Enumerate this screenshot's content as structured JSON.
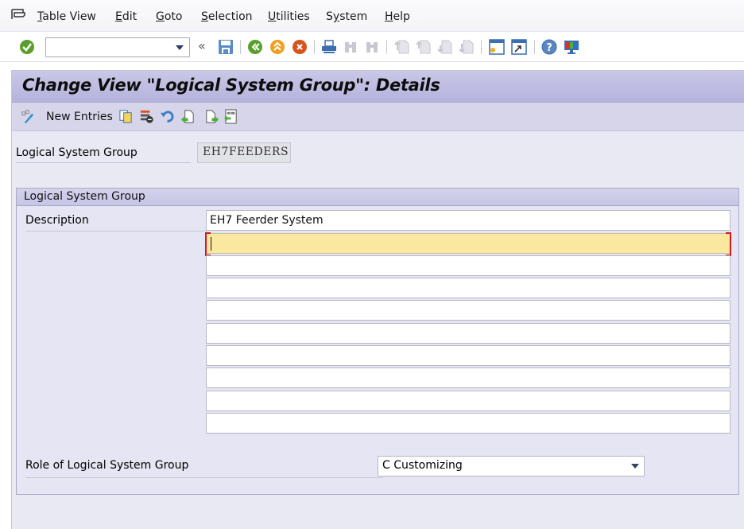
{
  "menubar": {
    "items": [
      {
        "label": "Table View",
        "mnemonic": "T"
      },
      {
        "label": "Edit",
        "mnemonic": "E"
      },
      {
        "label": "Goto",
        "mnemonic": "G"
      },
      {
        "label": "Selection",
        "mnemonic": "S"
      },
      {
        "label": "Utilities",
        "mnemonic": "U"
      },
      {
        "label": "System",
        "mnemonic": "y"
      },
      {
        "label": "Help",
        "mnemonic": "H"
      }
    ]
  },
  "toolbar": {
    "command_field_value": "",
    "icons": [
      "enter-icon",
      "save-icon",
      "back-icon",
      "exit-icon",
      "cancel-icon",
      "print-icon",
      "find-icon",
      "find-next-icon",
      "first-page-icon",
      "previous-page-icon",
      "next-page-icon",
      "last-page-icon",
      "create-session-icon",
      "generate-shortcut-icon",
      "help-icon",
      "customize-layout-icon"
    ],
    "collapse_symbol": "«"
  },
  "page": {
    "title": "Change View \"Logical System Group\": Details"
  },
  "app_toolbar": {
    "new_entries_label": "New Entries"
  },
  "header": {
    "label": "Logical System Group",
    "value": "EH7FEEDERS"
  },
  "group": {
    "title": "Logical System Group",
    "description_label": "Description",
    "description_lines": [
      "EH7 Feerder System",
      "",
      "",
      "",
      "",
      "",
      "",
      "",
      "",
      ""
    ],
    "active_line": 1,
    "role_label": "Role of Logical System Group",
    "role_value": "C Customizing"
  },
  "colors": {
    "title_bar": "#b5b3dd",
    "content_bg": "#e9e9f4",
    "active_field": "#fbe8a0",
    "focus_marker": "#d11a1a"
  }
}
